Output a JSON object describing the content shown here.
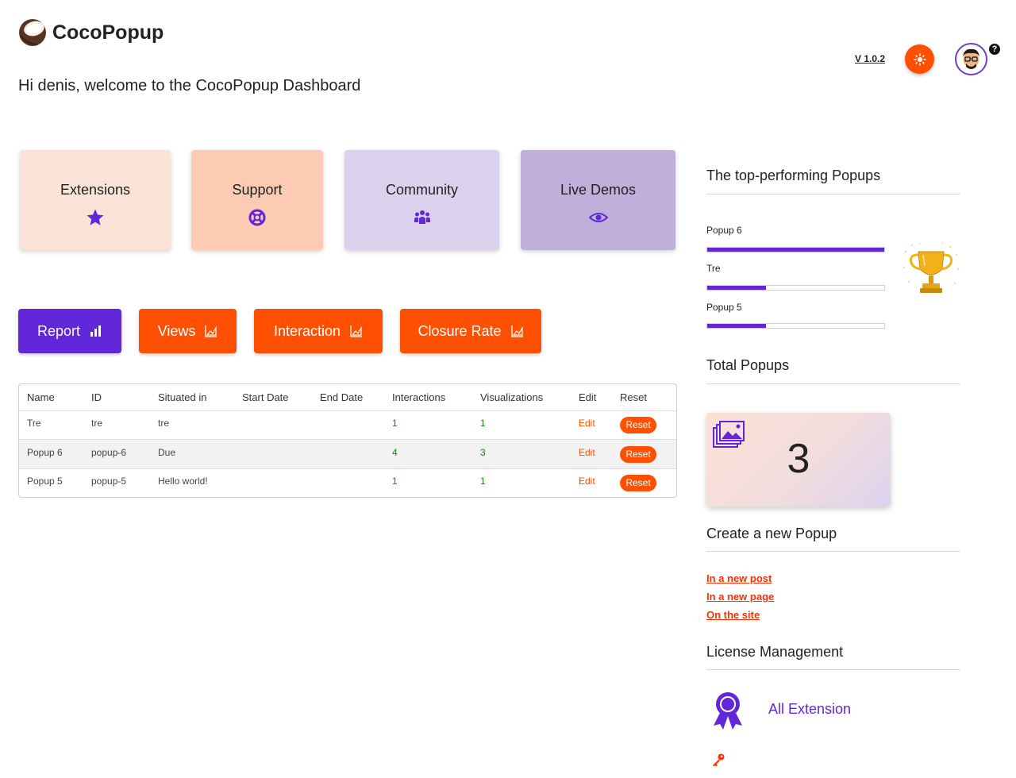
{
  "app": {
    "name": "CocoPopup",
    "version": "V 1.0.2"
  },
  "welcome": "Hi denis, welcome to the CocoPopup Dashboard",
  "cards": [
    {
      "label": "Extensions",
      "icon": "star-icon",
      "bg": "#fce3d7"
    },
    {
      "label": "Support",
      "icon": "lifebuoy-icon",
      "bg": "#fdcbb3"
    },
    {
      "label": "Community",
      "icon": "users-icon",
      "bg": "#ddd2ee"
    },
    {
      "label": "Live Demos",
      "icon": "eye-icon",
      "bg": "#c0aedb"
    }
  ],
  "tabs": [
    {
      "label": "Report",
      "icon": "bar-chart-icon",
      "color": "#6127d8",
      "active": true
    },
    {
      "label": "Views",
      "icon": "area-chart-icon",
      "color": "#fe5000"
    },
    {
      "label": "Interaction",
      "icon": "area-chart-icon",
      "color": "#fe5000"
    },
    {
      "label": "Closure Rate",
      "icon": "area-chart-icon",
      "color": "#fe5000"
    }
  ],
  "table": {
    "headers": [
      "Name",
      "ID",
      "Situated in",
      "Start Date",
      "End Date",
      "Interactions",
      "Visualizations",
      "Edit",
      "Reset"
    ],
    "rows": [
      {
        "name": "Tre",
        "id": "tre",
        "situated": "tre",
        "start": "",
        "end": "",
        "interactions": "1",
        "visualizations": "1",
        "edit": "Edit",
        "reset": "Reset"
      },
      {
        "name": "Popup 6",
        "id": "popup-6",
        "situated": "Due",
        "start": "",
        "end": "",
        "interactions": "4",
        "visualizations": "3",
        "edit": "Edit",
        "reset": "Reset"
      },
      {
        "name": "Popup 5",
        "id": "popup-5",
        "situated": "Hello world!",
        "start": "",
        "end": "",
        "interactions": "1",
        "visualizations": "1",
        "edit": "Edit",
        "reset": "Reset"
      }
    ]
  },
  "top_performing": {
    "title": "The top-performing Popups",
    "items": [
      {
        "name": "Popup 6",
        "fraction": 1.0
      },
      {
        "name": "Tre",
        "fraction": 0.33
      },
      {
        "name": "Popup 5",
        "fraction": 0.33
      }
    ]
  },
  "total": {
    "title": "Total Popups",
    "value": "3"
  },
  "create": {
    "title": "Create a new Popup",
    "links": [
      "In a new post",
      "In a new page",
      "On the site"
    ]
  },
  "license": {
    "title": "License Management",
    "item": "All Extension"
  },
  "colors": {
    "accent": "#fe5000",
    "brand": "#6127d8"
  }
}
